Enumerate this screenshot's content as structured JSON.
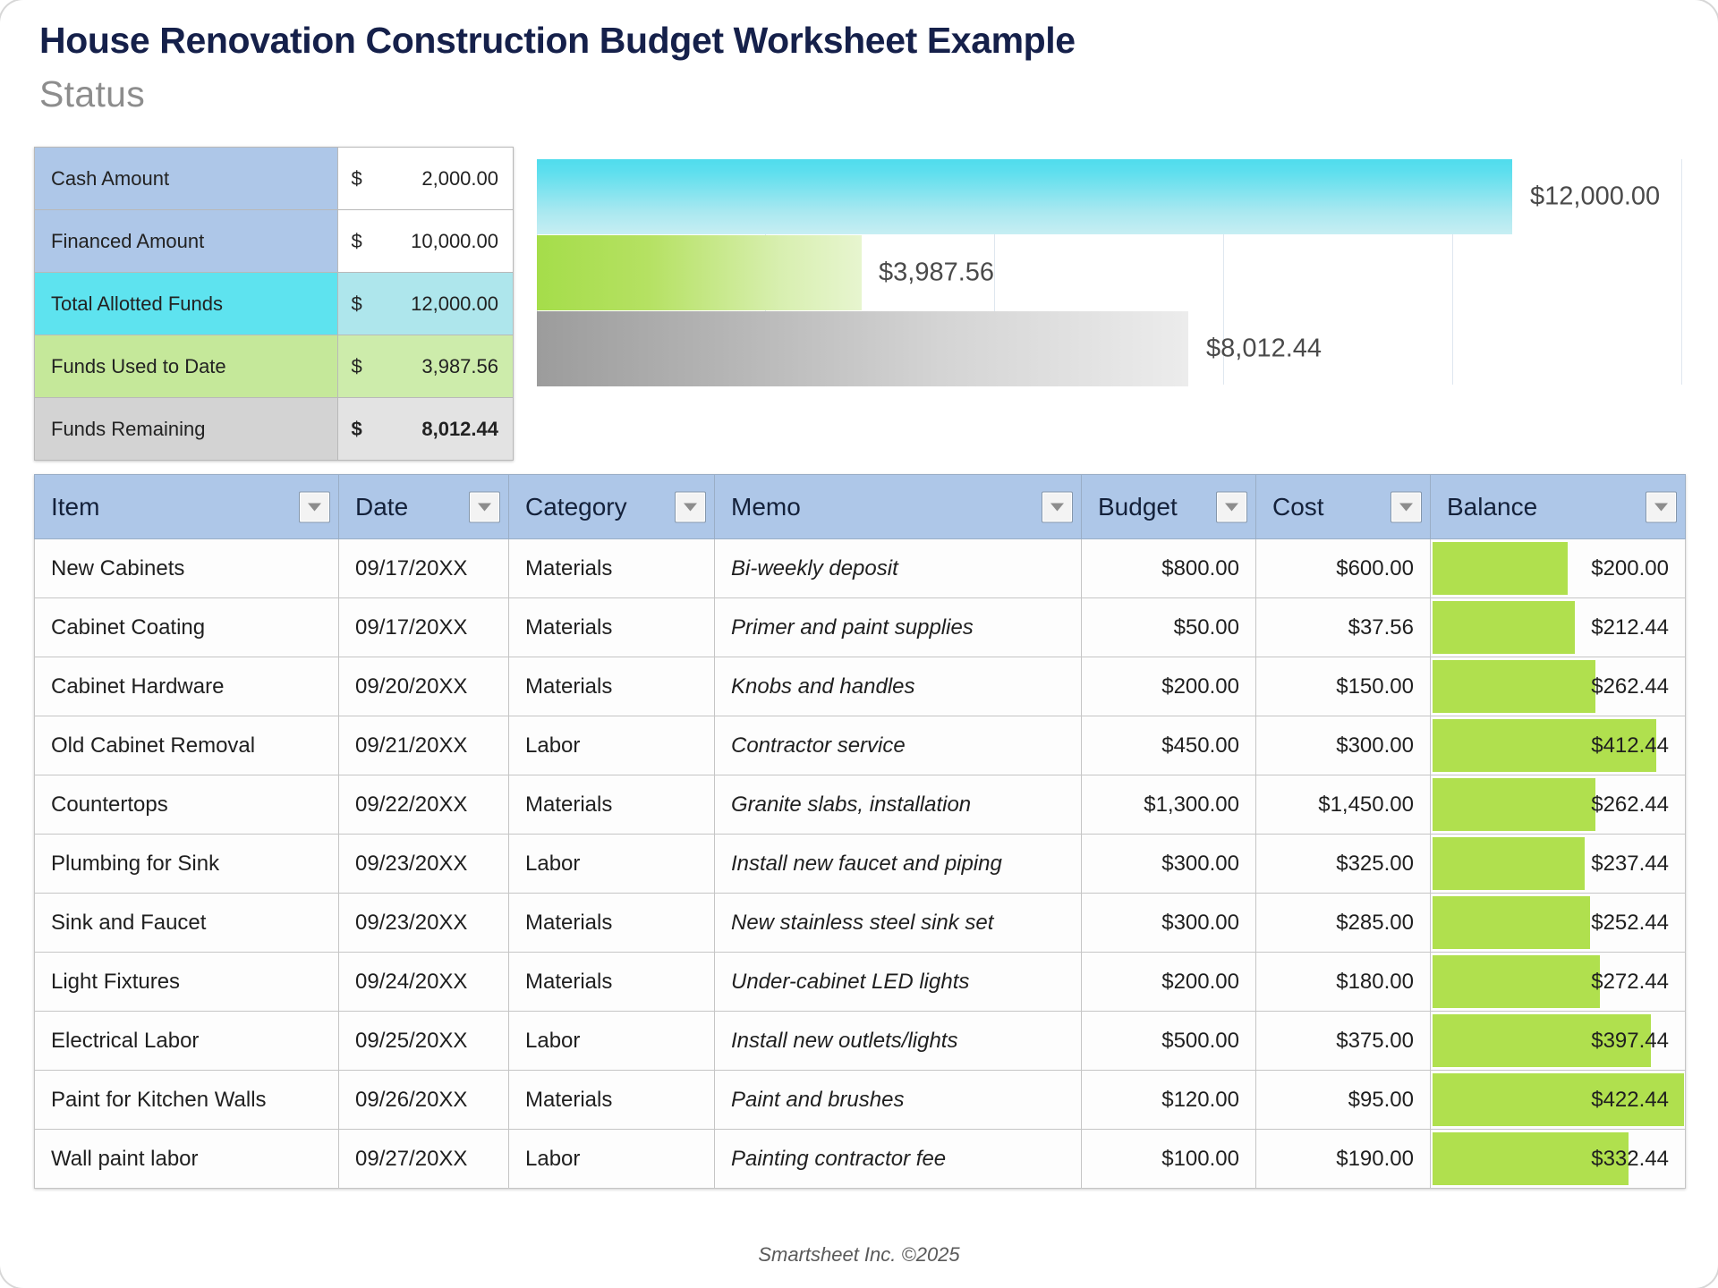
{
  "header": {
    "title": "House Renovation Construction Budget Worksheet Example",
    "subtitle": "Status"
  },
  "status": {
    "rows": [
      {
        "label": "Cash Amount",
        "currency": "$",
        "amount": "2,000.00"
      },
      {
        "label": "Financed Amount",
        "currency": "$",
        "amount": "10,000.00"
      },
      {
        "label": "Total Allotted Funds",
        "currency": "$",
        "amount": "12,000.00"
      },
      {
        "label": "Funds Used to Date",
        "currency": "$",
        "amount": "3,987.56"
      },
      {
        "label": "Funds Remaining",
        "currency": "$",
        "amount": "8,012.44"
      }
    ]
  },
  "chart_data": {
    "type": "bar",
    "orientation": "horizontal",
    "title": "",
    "xlabel": "",
    "ylabel": "",
    "categories": [
      "Total Allotted Funds",
      "Funds Used to Date",
      "Funds Remaining"
    ],
    "values": [
      12000.0,
      3987.56,
      8012.44
    ],
    "labels": [
      "$12,000.00",
      "$3,987.56",
      "$8,012.44"
    ],
    "colors": [
      "#5fdfee",
      "#b5e162",
      "#b4b4b4"
    ],
    "xlim": [
      0,
      12000
    ],
    "grid": true,
    "gridlines": [
      0,
      2400,
      4800,
      7200,
      9600,
      12000
    ],
    "legend": "none"
  },
  "table": {
    "columns": [
      {
        "label": "Item",
        "filter": "filter-dropdown-icon"
      },
      {
        "label": "Date",
        "filter": "filter-dropdown-icon"
      },
      {
        "label": "Category",
        "filter": "filter-dropdown-icon"
      },
      {
        "label": "Memo",
        "filter": "filter-dropdown-icon"
      },
      {
        "label": "Budget",
        "filter": "filter-dropdown-icon"
      },
      {
        "label": "Cost",
        "filter": "filter-dropdown-icon"
      },
      {
        "label": "Balance",
        "filter": "filter-dropdown-icon"
      }
    ],
    "rows": [
      {
        "item": "New Cabinets",
        "date": "09/17/20XX",
        "category": "Materials",
        "memo": "Bi-weekly deposit",
        "budget": "$800.00",
        "cost": "$600.00",
        "balance": "$200.00",
        "bar_pct": 53
      },
      {
        "item": "Cabinet Coating",
        "date": "09/17/20XX",
        "category": "Materials",
        "memo": "Primer and paint supplies",
        "budget": "$50.00",
        "cost": "$37.56",
        "balance": "$212.44",
        "bar_pct": 56
      },
      {
        "item": "Cabinet Hardware",
        "date": "09/20/20XX",
        "category": "Materials",
        "memo": "Knobs and handles",
        "budget": "$200.00",
        "cost": "$150.00",
        "balance": "$262.44",
        "bar_pct": 64
      },
      {
        "item": "Old Cabinet Removal",
        "date": "09/21/20XX",
        "category": "Labor",
        "memo": "Contractor service",
        "budget": "$450.00",
        "cost": "$300.00",
        "balance": "$412.44",
        "bar_pct": 88
      },
      {
        "item": "Countertops",
        "date": "09/22/20XX",
        "category": "Materials",
        "memo": "Granite slabs, installation",
        "budget": "$1,300.00",
        "cost": "$1,450.00",
        "balance": "$262.44",
        "bar_pct": 64
      },
      {
        "item": "Plumbing for Sink",
        "date": "09/23/20XX",
        "category": "Labor",
        "memo": "Install new faucet and piping",
        "budget": "$300.00",
        "cost": "$325.00",
        "balance": "$237.44",
        "bar_pct": 60
      },
      {
        "item": "Sink and Faucet",
        "date": "09/23/20XX",
        "category": "Materials",
        "memo": "New stainless steel sink set",
        "budget": "$300.00",
        "cost": "$285.00",
        "balance": "$252.44",
        "bar_pct": 62
      },
      {
        "item": "Light Fixtures",
        "date": "09/24/20XX",
        "category": "Materials",
        "memo": "Under-cabinet LED lights",
        "budget": "$200.00",
        "cost": "$180.00",
        "balance": "$272.44",
        "bar_pct": 66
      },
      {
        "item": "Electrical Labor",
        "date": "09/25/20XX",
        "category": "Labor",
        "memo": "Install new outlets/lights",
        "budget": "$500.00",
        "cost": "$375.00",
        "balance": "$397.44",
        "bar_pct": 86
      },
      {
        "item": "Paint for Kitchen Walls",
        "date": "09/26/20XX",
        "category": "Materials",
        "memo": "Paint and brushes",
        "budget": "$120.00",
        "cost": "$95.00",
        "balance": "$422.44",
        "bar_pct": 99
      },
      {
        "item": "Wall paint labor",
        "date": "09/27/20XX",
        "category": "Labor",
        "memo": "Painting contractor fee",
        "budget": "$100.00",
        "cost": "$190.00",
        "balance": "$332.44",
        "bar_pct": 77
      }
    ]
  },
  "footer": {
    "text": "Smartsheet Inc. ©2025"
  }
}
